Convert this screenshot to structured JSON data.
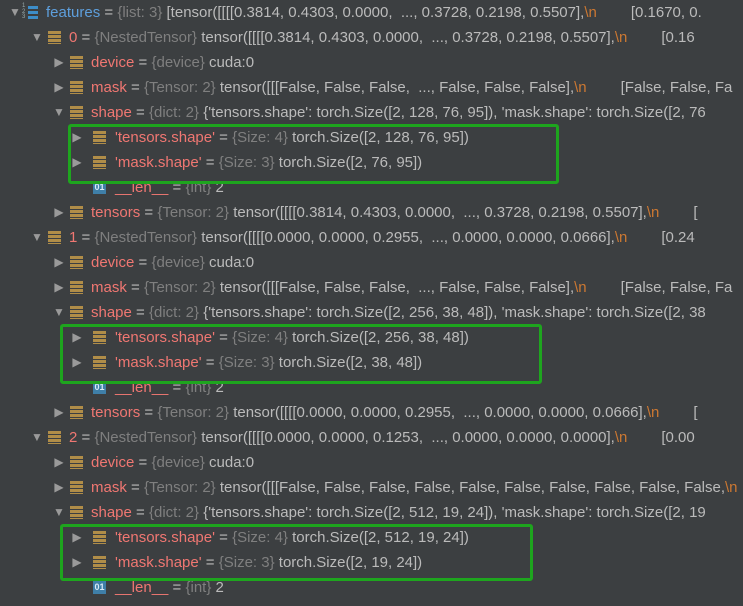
{
  "colors": {
    "name": "#f07772",
    "root_name": "#5e9fdc",
    "type": "#7f7f7f",
    "value": "#bbbbbb",
    "newline": "#cc7832",
    "highlight_box": "#1ea51e",
    "background": "#3c3f41"
  },
  "rows": [
    {
      "level": 0,
      "toggle": "expanded",
      "icon": "list-icon",
      "name": "features",
      "type": "{list: 3}",
      "value": "[tensor([[[[0.3814, 0.4303, 0.0000,  ..., 0.3728, 0.2198, 0.5507],",
      "nl": "\\n",
      "tail": "[0.1670, 0."
    },
    {
      "level": 1,
      "toggle": "expanded",
      "icon": "object-icon",
      "name": "0",
      "type": "{NestedTensor}",
      "value": "tensor([[[[0.3814, 0.4303, 0.0000,  ..., 0.3728, 0.2198, 0.5507],",
      "nl": "\\n",
      "tail": "[0.16"
    },
    {
      "level": 2,
      "toggle": "collapsed",
      "icon": "object-icon",
      "name": "device",
      "type": "{device}",
      "value": "cuda:0"
    },
    {
      "level": 2,
      "toggle": "collapsed",
      "icon": "object-icon",
      "name": "mask",
      "type": "{Tensor: 2}",
      "value": "tensor([[[False, False, False,  ..., False, False, False],",
      "nl": "\\n",
      "tail": "[False, False, Fa"
    },
    {
      "level": 2,
      "toggle": "expanded",
      "icon": "object-icon",
      "name": "shape",
      "type": "{dict: 2}",
      "value": "{'tensors.shape': torch.Size([2, 128, 76, 95]), 'mask.shape': torch.Size([2, 76"
    },
    {
      "level": 3,
      "toggle": "collapsed",
      "icon": "object-icon",
      "name": "'tensors.shape'",
      "type": "{Size: 4}",
      "value": "torch.Size([2, 128, 76, 95])"
    },
    {
      "level": 3,
      "toggle": "collapsed",
      "icon": "object-icon",
      "name": "'mask.shape'",
      "type": "{Size: 3}",
      "value": "torch.Size([2, 76, 95])"
    },
    {
      "level": 3,
      "toggle": "none",
      "icon": "int-icon",
      "name": "__len__",
      "type": "{int}",
      "value": "2"
    },
    {
      "level": 2,
      "toggle": "collapsed",
      "icon": "object-icon",
      "name": "tensors",
      "type": "{Tensor: 2}",
      "value": "tensor([[[[0.3814, 0.4303, 0.0000,  ..., 0.3728, 0.2198, 0.5507],",
      "nl": "\\n",
      "tail": "["
    },
    {
      "level": 1,
      "toggle": "expanded",
      "icon": "object-icon",
      "name": "1",
      "type": "{NestedTensor}",
      "value": "tensor([[[[0.0000, 0.0000, 0.2955,  ..., 0.0000, 0.0000, 0.0666],",
      "nl": "\\n",
      "tail": "[0.24"
    },
    {
      "level": 2,
      "toggle": "collapsed",
      "icon": "object-icon",
      "name": "device",
      "type": "{device}",
      "value": "cuda:0"
    },
    {
      "level": 2,
      "toggle": "collapsed",
      "icon": "object-icon",
      "name": "mask",
      "type": "{Tensor: 2}",
      "value": "tensor([[[False, False, False,  ..., False, False, False],",
      "nl": "\\n",
      "tail": "[False, False, Fa"
    },
    {
      "level": 2,
      "toggle": "expanded",
      "icon": "object-icon",
      "name": "shape",
      "type": "{dict: 2}",
      "value": "{'tensors.shape': torch.Size([2, 256, 38, 48]), 'mask.shape': torch.Size([2, 38"
    },
    {
      "level": 3,
      "toggle": "collapsed",
      "icon": "object-icon",
      "name": "'tensors.shape'",
      "type": "{Size: 4}",
      "value": "torch.Size([2, 256, 38, 48])"
    },
    {
      "level": 3,
      "toggle": "collapsed",
      "icon": "object-icon",
      "name": "'mask.shape'",
      "type": "{Size: 3}",
      "value": "torch.Size([2, 38, 48])"
    },
    {
      "level": 3,
      "toggle": "none",
      "icon": "int-icon",
      "name": "__len__",
      "type": "{int}",
      "value": "2"
    },
    {
      "level": 2,
      "toggle": "collapsed",
      "icon": "object-icon",
      "name": "tensors",
      "type": "{Tensor: 2}",
      "value": "tensor([[[[0.0000, 0.0000, 0.2955,  ..., 0.0000, 0.0000, 0.0666],",
      "nl": "\\n",
      "tail": "["
    },
    {
      "level": 1,
      "toggle": "expanded",
      "icon": "object-icon",
      "name": "2",
      "type": "{NestedTensor}",
      "value": "tensor([[[[0.0000, 0.0000, 0.1253,  ..., 0.0000, 0.0000, 0.0000],",
      "nl": "\\n",
      "tail": "[0.00"
    },
    {
      "level": 2,
      "toggle": "collapsed",
      "icon": "object-icon",
      "name": "device",
      "type": "{device}",
      "value": "cuda:0"
    },
    {
      "level": 2,
      "toggle": "collapsed",
      "icon": "object-icon",
      "name": "mask",
      "type": "{Tensor: 2}",
      "value": "tensor([[[False, False, False, False, False, False, False, False, False, False,",
      "nl": "\\n"
    },
    {
      "level": 2,
      "toggle": "expanded",
      "icon": "object-icon",
      "name": "shape",
      "type": "{dict: 2}",
      "value": "{'tensors.shape': torch.Size([2, 512, 19, 24]), 'mask.shape': torch.Size([2, 19"
    },
    {
      "level": 3,
      "toggle": "collapsed",
      "icon": "object-icon",
      "name": "'tensors.shape'",
      "type": "{Size: 4}",
      "value": "torch.Size([2, 512, 19, 24])"
    },
    {
      "level": 3,
      "toggle": "collapsed",
      "icon": "object-icon",
      "name": "'mask.shape'",
      "type": "{Size: 3}",
      "value": "torch.Size([2, 19, 24])"
    },
    {
      "level": 3,
      "toggle": "none",
      "icon": "int-icon",
      "name": "__len__",
      "type": "{int}",
      "value": "2"
    }
  ]
}
